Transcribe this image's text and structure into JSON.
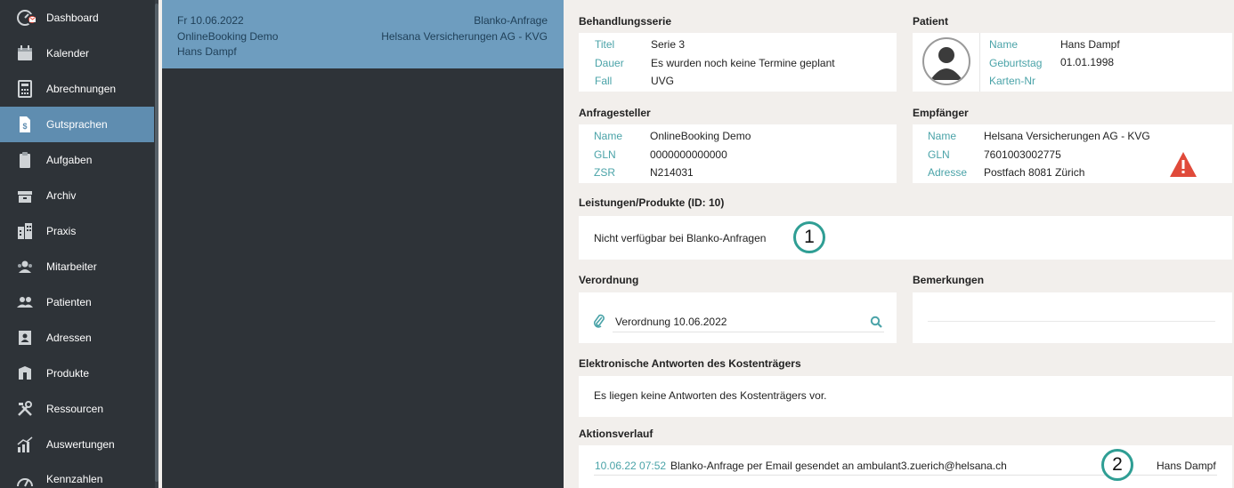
{
  "sidebar": {
    "items": [
      {
        "label": "Dashboard",
        "icon": "dashboard-icon"
      },
      {
        "label": "Kalender",
        "icon": "calendar-icon"
      },
      {
        "label": "Abrechnungen",
        "icon": "calculator-icon"
      },
      {
        "label": "Gutsprachen",
        "icon": "document-dollar-icon"
      },
      {
        "label": "Aufgaben",
        "icon": "clipboard-icon"
      },
      {
        "label": "Archiv",
        "icon": "archive-icon"
      },
      {
        "label": "Praxis",
        "icon": "building-icon"
      },
      {
        "label": "Mitarbeiter",
        "icon": "staff-icon"
      },
      {
        "label": "Patienten",
        "icon": "patients-icon"
      },
      {
        "label": "Adressen",
        "icon": "address-book-icon"
      },
      {
        "label": "Produkte",
        "icon": "products-icon"
      },
      {
        "label": "Ressourcen",
        "icon": "tools-icon"
      },
      {
        "label": "Auswertungen",
        "icon": "chart-icon"
      },
      {
        "label": "Kennzahlen",
        "icon": "gauge-icon"
      }
    ],
    "active_index": 3
  },
  "list": {
    "card": {
      "date": "Fr 10.06.2022",
      "sender": "OnlineBooking Demo",
      "patient": "Hans Dampf",
      "type": "Blanko-Anfrage",
      "recipient": "Helsana Versicherungen AG - KVG"
    }
  },
  "detail": {
    "behandlungsserie": {
      "title": "Behandlungsserie",
      "rows": [
        {
          "k": "Titel",
          "v": "Serie 3"
        },
        {
          "k": "Dauer",
          "v": "Es wurden noch keine Termine geplant"
        },
        {
          "k": "Fall",
          "v": "UVG"
        }
      ]
    },
    "patient": {
      "title": "Patient",
      "rows": [
        {
          "k": "Name",
          "v": "Hans Dampf"
        },
        {
          "k": "Geburtstag",
          "v": "01.01.1998"
        },
        {
          "k": "Karten-Nr",
          "v": ""
        }
      ]
    },
    "anfragesteller": {
      "title": "Anfragesteller",
      "rows": [
        {
          "k": "Name",
          "v": "OnlineBooking Demo"
        },
        {
          "k": "GLN",
          "v": "0000000000000"
        },
        {
          "k": "ZSR",
          "v": "N214031"
        }
      ]
    },
    "empfaenger": {
      "title": "Empfänger",
      "rows": [
        {
          "k": "Name",
          "v": "Helsana Versicherungen AG - KVG"
        },
        {
          "k": "GLN",
          "v": "7601003002775"
        },
        {
          "k": "Adresse",
          "v": "Postfach 8081 Zürich"
        }
      ]
    },
    "leistungen": {
      "title": "Leistungen/Produkte (ID: 10)",
      "text": "Nicht verfügbar bei Blanko-Anfragen",
      "marker": "1"
    },
    "verordnung": {
      "title": "Verordnung",
      "file": "Verordnung 10.06.2022"
    },
    "bemerkungen": {
      "title": "Bemerkungen"
    },
    "antworten": {
      "title": "Elektronische Antworten des Kostenträgers",
      "text": "Es liegen keine Antworten des Kostenträgers vor."
    },
    "aktionsverlauf": {
      "title": "Aktionsverlauf",
      "entries": [
        {
          "time": "10.06.22 07:52",
          "text": "Blanko-Anfrage per Email gesendet an ambulant3.zuerich@helsana.ch",
          "user": "Hans Dampf"
        }
      ],
      "marker": "2"
    }
  },
  "colors": {
    "sidebar_bg": "#2e3338",
    "active_bg": "#5f8db0",
    "accent_teal": "#4aa3a8",
    "warning": "#e04a3a"
  }
}
